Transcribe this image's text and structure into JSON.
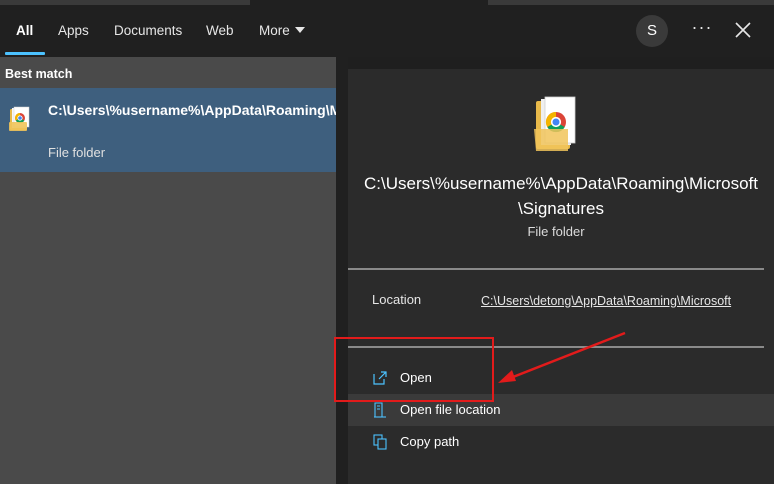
{
  "nav": {
    "tabs": [
      {
        "label": "All",
        "active": true
      },
      {
        "label": "Apps"
      },
      {
        "label": "Documents"
      },
      {
        "label": "Web"
      },
      {
        "label": "More"
      }
    ],
    "avatar_initial": "S",
    "more_options_label": "···"
  },
  "left": {
    "section_title": "Best match",
    "result": {
      "title": "C:\\Users\\%username%\\AppData\\Roaming\\Microsoft\\Signatures",
      "subtitle": "File folder"
    }
  },
  "preview": {
    "title": "C:\\Users\\%username%\\AppData\\Roaming\\Microsoft\\Signatures",
    "subtitle": "File folder",
    "location_label": "Location",
    "location_value": "C:\\Users\\detong\\AppData\\Roaming\\Microsoft"
  },
  "actions": [
    {
      "label": "Open",
      "icon": "open-icon"
    },
    {
      "label": "Open file location",
      "icon": "folder-location-icon"
    },
    {
      "label": "Copy path",
      "icon": "copy-icon"
    }
  ],
  "colors": {
    "accent": "#4cc2ff",
    "selection": "#3e5f7e",
    "annotation": "#e21b1b"
  }
}
